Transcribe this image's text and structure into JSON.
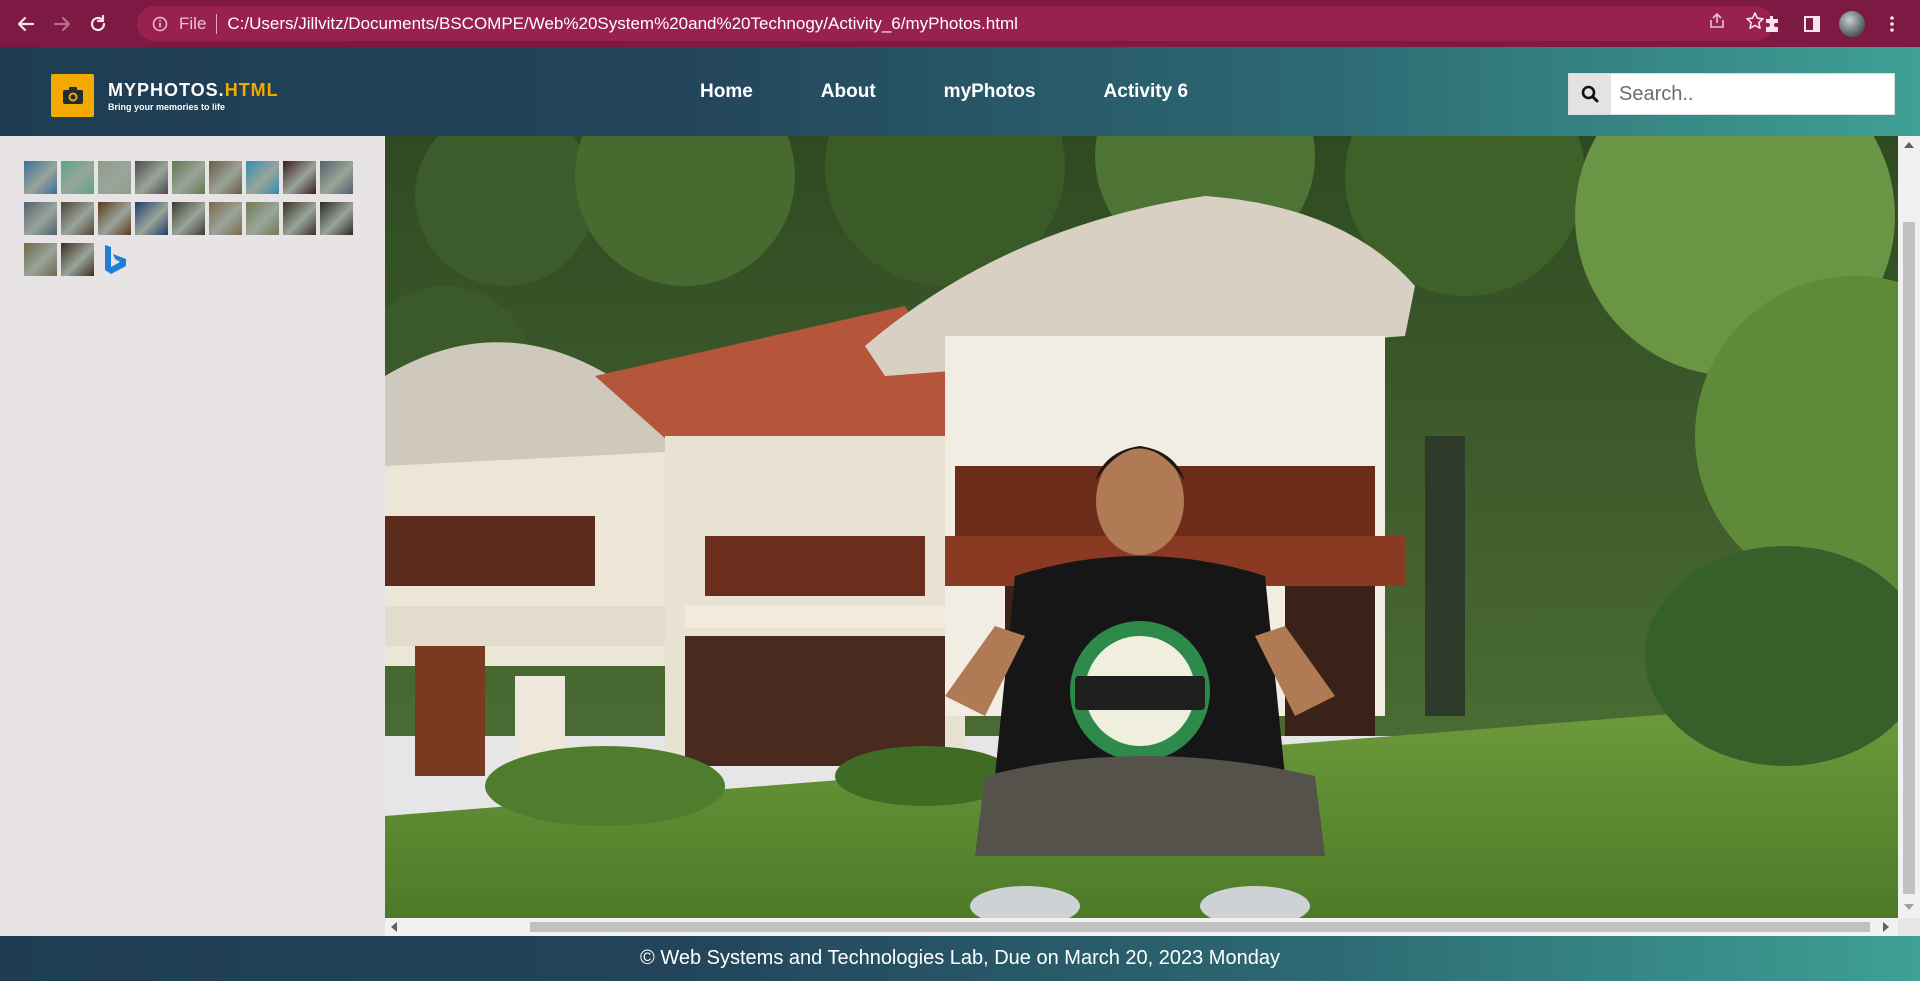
{
  "browser": {
    "file_label": "File",
    "url": "C:/Users/Jillvitz/Documents/BSCOMPE/Web%20System%20and%20Technogy/Activity_6/myPhotos.html",
    "icons": [
      "back-icon",
      "forward-icon",
      "reload-icon",
      "info-icon",
      "share-icon",
      "star-icon",
      "extensions-icon",
      "sidepanel-icon",
      "profile-avatar",
      "menu-icon"
    ]
  },
  "site": {
    "logo_title_main": "MYPHOTOS.",
    "logo_title_accent": "HTML",
    "logo_tagline": "Bring your memories to life",
    "nav": [
      "Home",
      "About",
      "myPhotos",
      "Activity 6"
    ],
    "search_placeholder": "Search.."
  },
  "sidebar": {
    "thumbnail_colors": [
      "#3b6f99",
      "#5aa58a",
      "#8f9c8a",
      "#4d4a4e",
      "#5f7a52",
      "#6b5a45",
      "#2f8fb0",
      "#3a1d1d",
      "#55606b",
      "#50626f",
      "#4f4438",
      "#5a3a1c",
      "#1d3e6b",
      "#3d3d33",
      "#7a6b4e",
      "#6d7d52",
      "#3d3025",
      "#2c2a24",
      "#6d6a4a",
      "#3a2f22"
    ],
    "bing_icon": "bing-logo-icon"
  },
  "footer": {
    "text": "© Web Systems and Technologies Lab, Due on March 20, 2023 Monday"
  },
  "colors": {
    "chrome_bar": "#7d1a44",
    "omnibox": "#98214f",
    "header_start": "#1e3d52",
    "header_end": "#3fa094",
    "logo_accent": "#f2a900"
  }
}
